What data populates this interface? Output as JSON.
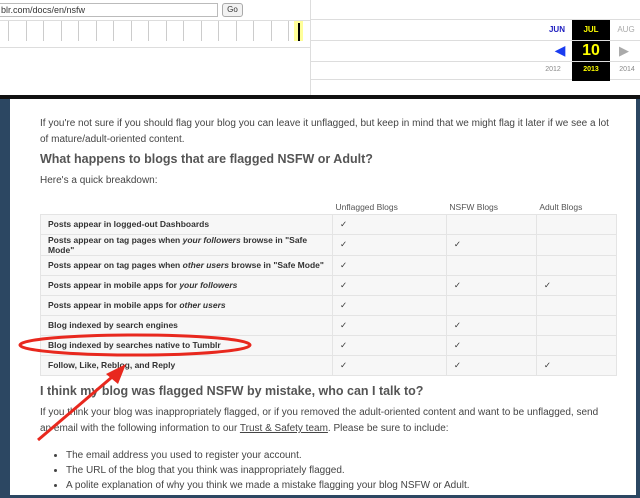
{
  "wayback": {
    "url": "blr.com/docs/en/nsfw",
    "go_label": "Go",
    "months": [
      "JUN",
      "JUL",
      "AUG"
    ],
    "day": "10",
    "years": [
      "2012",
      "2013",
      "2014"
    ]
  },
  "article": {
    "intro": "If you're not sure if you should flag your blog you can leave it unflagged, but keep in mind that we might flag it later if we see a lot of mature/adult-oriented content.",
    "h1": "What happens to blogs that are flagged NSFW or Adult?",
    "breakdown": "Here's a quick breakdown:",
    "columns": [
      "Unflagged Blogs",
      "NSFW Blogs",
      "Adult Blogs"
    ],
    "rows": [
      {
        "pre": "Posts appear in logged-out Dashboards",
        "em": "",
        "post": "",
        "c": [
          "✓",
          "",
          ""
        ]
      },
      {
        "pre": "Posts appear on tag pages when ",
        "em": "your followers",
        "post": " browse in \"Safe Mode\"",
        "c": [
          "✓",
          "✓",
          ""
        ]
      },
      {
        "pre": "Posts appear on tag pages when ",
        "em": "other users",
        "post": " browse in \"Safe Mode\"",
        "c": [
          "✓",
          "",
          ""
        ]
      },
      {
        "pre": "Posts appear in mobile apps for ",
        "em": "your followers",
        "post": "",
        "c": [
          "✓",
          "✓",
          "✓"
        ]
      },
      {
        "pre": "Posts appear in mobile apps for ",
        "em": "other users",
        "post": "",
        "c": [
          "✓",
          "",
          ""
        ]
      },
      {
        "pre": "Blog indexed by search engines",
        "em": "",
        "post": "",
        "c": [
          "✓",
          "✓",
          ""
        ]
      },
      {
        "pre": "Blog indexed by searches native to Tumblr",
        "em": "",
        "post": "",
        "c": [
          "✓",
          "✓",
          ""
        ]
      },
      {
        "pre": "Follow, Like, Reblog, and Reply",
        "em": "",
        "post": "",
        "c": [
          "✓",
          "✓",
          "✓"
        ]
      }
    ],
    "h2": "I think my blog was flagged NSFW by mistake, who can I talk to?",
    "p2a": "If you think your blog was inappropriately flagged, or if you removed the adult-oriented content and want to be unflagged, send an email with the following information to our ",
    "p2link": "Trust & Safety team",
    "p2b": ". Please be sure to include:",
    "bullets": [
      "The email address you used to register your account.",
      "The URL of the blog that you think was inappropriately flagged.",
      "A polite explanation of why you think we made a mistake flagging your blog NSFW or Adult."
    ]
  },
  "colors": {
    "annotation": "#e8281e",
    "bg": "#2c4762"
  }
}
